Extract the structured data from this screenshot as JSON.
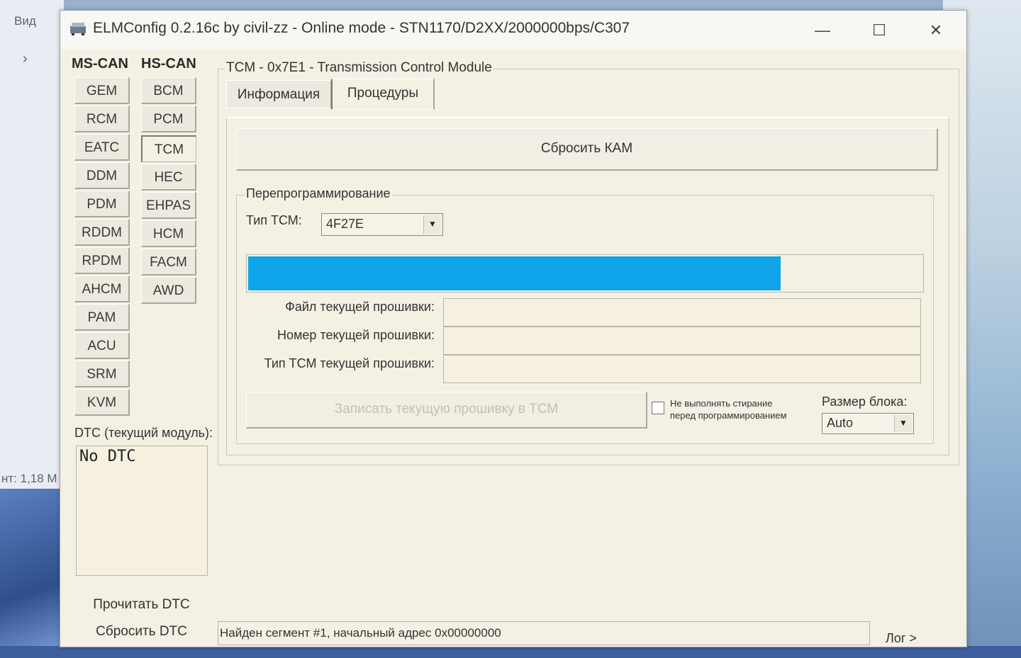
{
  "desktop": {
    "menu_label": "Вид",
    "chevron": "›",
    "size_text": "нт: 1,18 М"
  },
  "window": {
    "title": "ELMConfig 0.2.16c by civil-zz - Online mode - STN1170/D2XX/2000000bps/C307",
    "minimize": "—",
    "maximize": "☐",
    "close": "✕"
  },
  "modules": {
    "ms_can_header": "MS-CAN",
    "hs_can_header": "HS-CAN",
    "ms_can": [
      "GEM",
      "RCM",
      "EATC",
      "DDM",
      "PDM",
      "RDDM",
      "RPDM",
      "AHCM",
      "PAM",
      "ACU",
      "SRM",
      "KVM"
    ],
    "hs_can": [
      "BCM",
      "PCM",
      "TCM",
      "HEC",
      "EHPAS",
      "HCM",
      "FACM",
      "AWD"
    ],
    "selected": "TCM"
  },
  "dtc": {
    "label": "DTC (текущий модуль):",
    "content": "No DTC",
    "read_button": "Прочитать DTC",
    "reset_button": "Сбросить DTC"
  },
  "module_panel": {
    "title": "TCM - 0x7E1 - Transmission Control Module",
    "tabs": [
      "Информация",
      "Процедуры"
    ],
    "active_tab": "Процедуры",
    "reset_kam_button": "Сбросить КАМ"
  },
  "reprogramming": {
    "group_label": "Перепрограммирование",
    "tcm_type_label": "Тип ТСМ:",
    "tcm_type_value": "4F27E",
    "progress_fraction": 0.79,
    "progress_color": "#10a4ea",
    "fields": [
      {
        "label": "Файл текущей прошивки:",
        "value": ""
      },
      {
        "label": "Номер текущей прошивки:",
        "value": ""
      },
      {
        "label": "Тип ТСМ текущей прошивки:",
        "value": ""
      }
    ],
    "write_button": "Записать текущую прошивку в ТСМ",
    "no_erase_line1": "Не выполнять стирание",
    "no_erase_line2": "перед программированием",
    "block_size_label": "Размер блока:",
    "block_size_value": "Auto"
  },
  "status_bar": {
    "message": "Найден сегмент #1, начальный адрес 0x00000000",
    "log_button": "Лог >"
  }
}
